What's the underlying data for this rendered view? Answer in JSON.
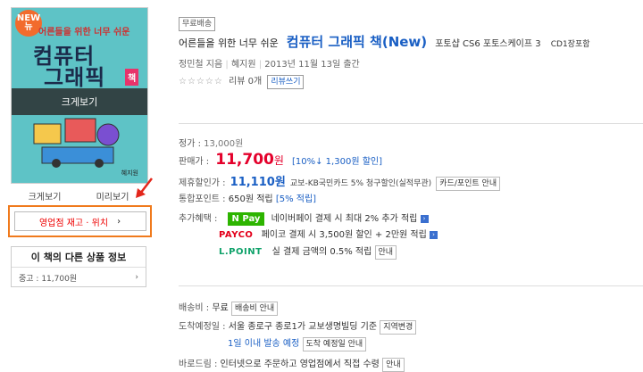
{
  "cover": {
    "badge": "NEW 뉴",
    "subtitle": "어른들을 위한 너무 쉬운",
    "title_line1": "컴퓨터",
    "title_line2": "그래픽",
    "title_badge": "책",
    "zoom_label": "크게보기",
    "publisher": "혜지원"
  },
  "tools": [
    "크게보기",
    "미리보기"
  ],
  "store_button": {
    "label": "영업점 재고 · 위치",
    "arrow": "›"
  },
  "other_products": {
    "title": "이 책의 다른 상품 정보",
    "item_label": "중고 : 11,700원",
    "arrow": "›"
  },
  "product": {
    "free_shipping": "무료배송",
    "title_prefix": "어른들을 위한 너무 쉬운",
    "title_main": "컴퓨터 그래픽 책(New)",
    "title_suffix": "포토샵 CS6 포토스케이프 3",
    "cd_label": "CD1장포함",
    "author": "정민철 지음",
    "publisher": "혜지원",
    "date": "2013년 11월 13일 출간",
    "stars": "☆☆☆☆☆",
    "review_count": "리뷰 0개",
    "review_write": "리뷰쓰기"
  },
  "price": {
    "list_label": "정가 :",
    "list_value": "13,000원",
    "sale_label": "판매가 :",
    "sale_value": "11,700",
    "sale_unit": "원",
    "discount": "[10%↓ 1,300원 할인]",
    "partner_label": "제휴할인가 :",
    "partner_value": "11,110원",
    "partner_desc": "교보-KB국민카드 5% 청구할인(실적무관)",
    "partner_btn": "카드/포인트 안내",
    "point_label": "통합포인트 :",
    "point_value": "650원 적립",
    "point_rate": "[5% 적립]"
  },
  "benefits": {
    "label": "추가혜택 :",
    "npay_logo": "N Pay",
    "npay_text": "네이버페이 결제 시 최대 2% 추가 적립",
    "payco_logo": "PAYCO",
    "payco_text": "페이코 결제 시 3,500원 할인 + 2만원 적립",
    "lpoint_logo": "L.POINT",
    "lpoint_text": "실 결제 금액의 0.5% 적립",
    "lpoint_btn": "안내"
  },
  "delivery": {
    "fee_label": "배송비 :",
    "fee_value": "무료",
    "fee_btn": "배송비 안내",
    "eta_label": "도착예정일 :",
    "eta_location": "서울 종로구 종로1가 교보생명빌딩 기준",
    "eta_btn": "지역변경",
    "eta_value": "1일 이내 발송 예정",
    "eta_info_btn": "도착 예정일 안내",
    "baro_label": "바로드림 :",
    "baro_text": "인터넷으로 주문하고 영업점에서 직접 수령",
    "baro_btn": "안내"
  },
  "colors": {
    "sale_red": "#e4002b",
    "link_blue": "#1a5fc4",
    "highlight_orange": "#f07a1c",
    "npay_green": "#2db400"
  }
}
